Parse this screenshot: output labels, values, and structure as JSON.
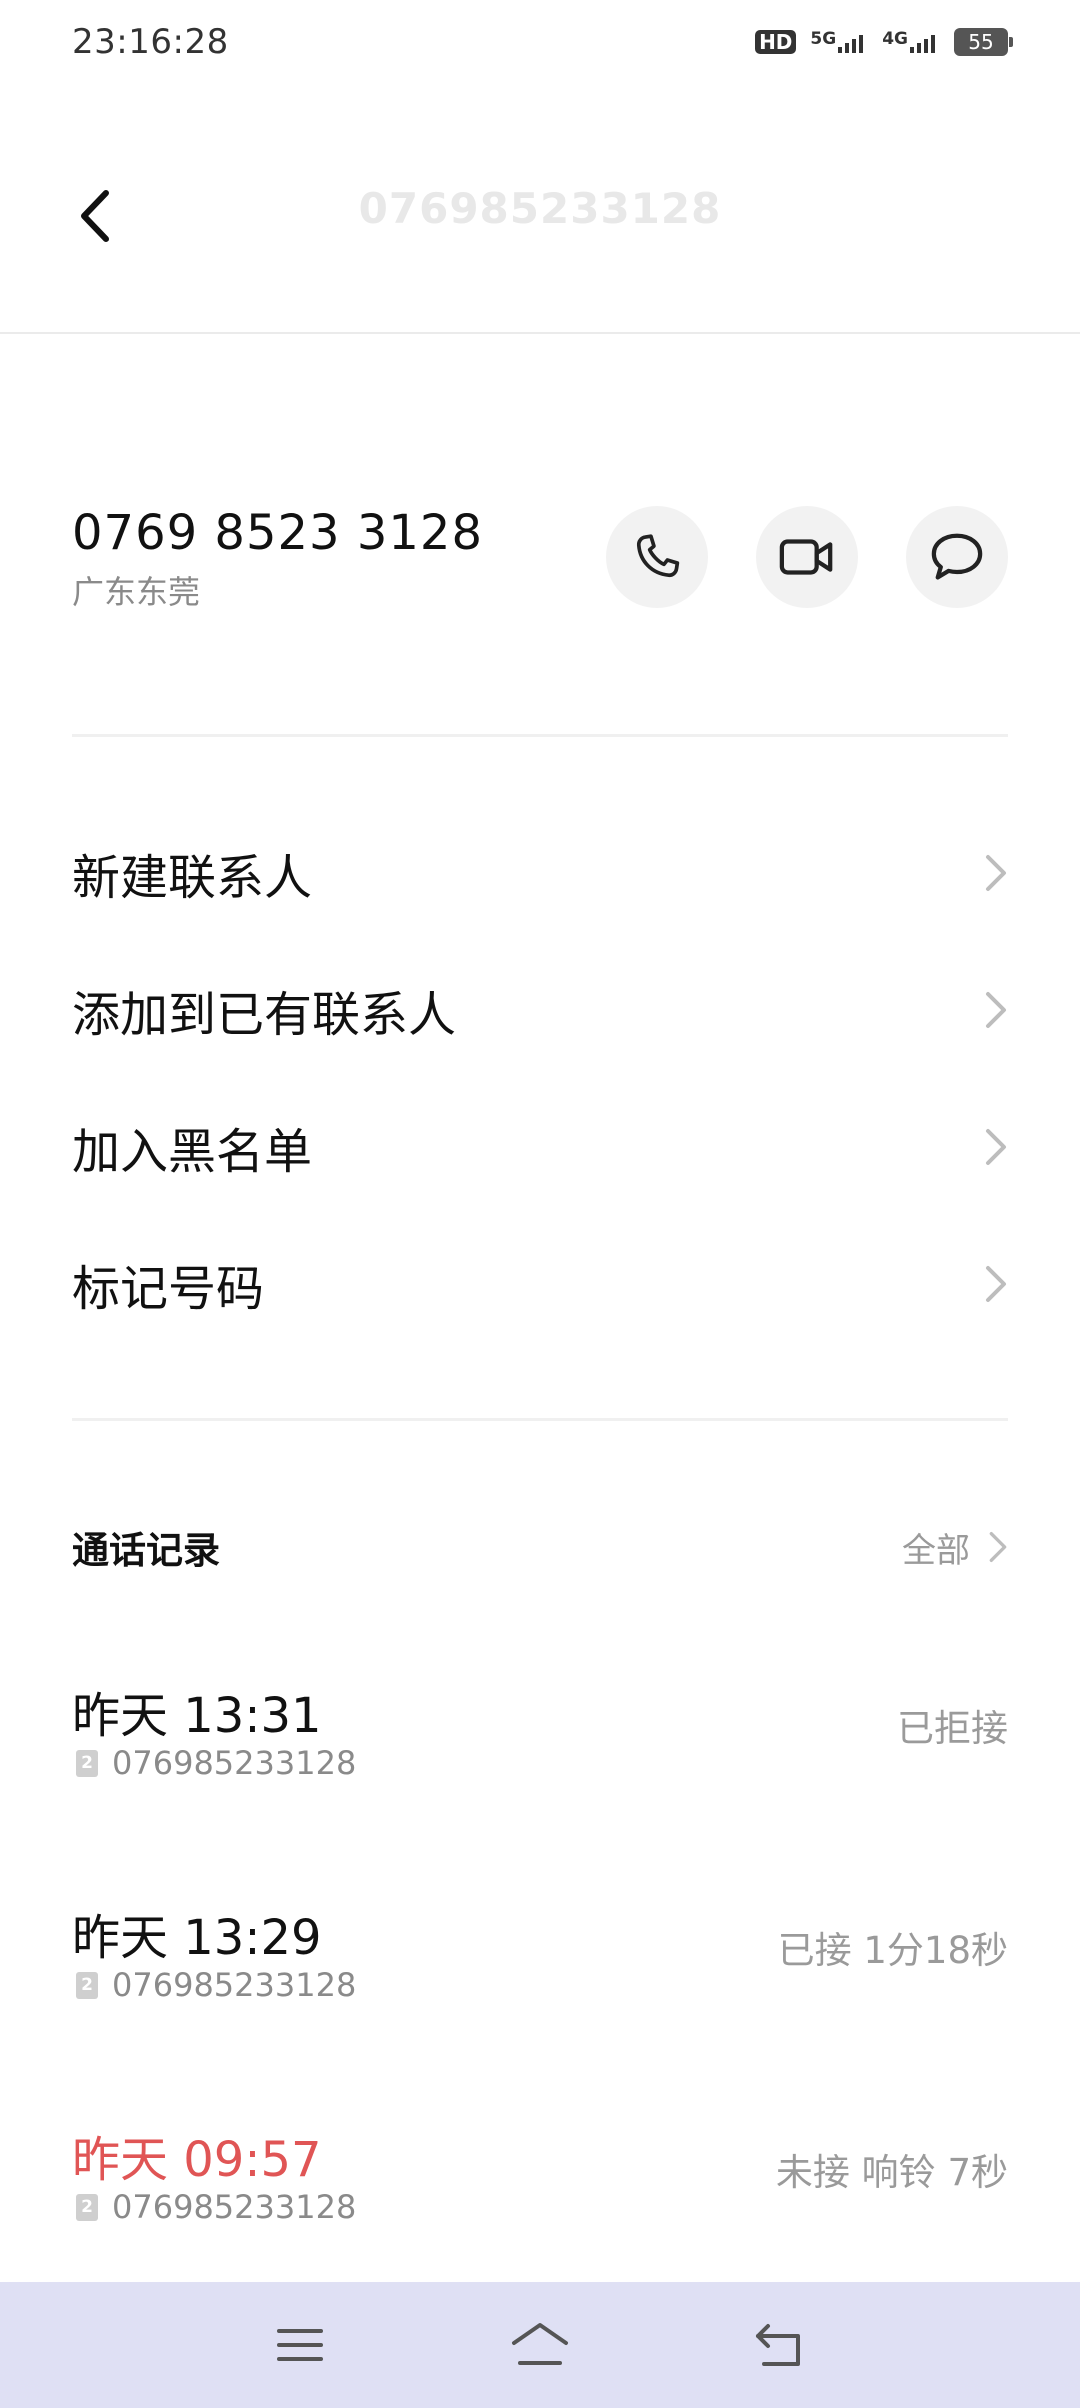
{
  "status_bar": {
    "time": "23:16:28",
    "hd_label": "HD",
    "sim1_net": "5G",
    "sim2_net": "4G",
    "battery": "55"
  },
  "header": {
    "title": "076985233128",
    "back_icon": "chevron-left-icon"
  },
  "contact": {
    "number": "0769 8523 3128",
    "region": "广东东莞",
    "actions": [
      {
        "name": "call",
        "icon": "phone-icon"
      },
      {
        "name": "video",
        "icon": "video-camera-icon"
      },
      {
        "name": "message",
        "icon": "chat-bubble-icon"
      }
    ]
  },
  "menu": {
    "items": [
      {
        "label": "新建联系人"
      },
      {
        "label": "添加到已有联系人"
      },
      {
        "label": "加入黑名单"
      },
      {
        "label": "标记号码"
      }
    ]
  },
  "records": {
    "title": "通话记录",
    "all_label": "全部",
    "items": [
      {
        "time": "昨天 13:31",
        "sim": "2",
        "number": "076985233128",
        "status": "已拒接",
        "missed": false
      },
      {
        "time": "昨天 13:29",
        "sim": "2",
        "number": "076985233128",
        "status": "已接 1分18秒",
        "missed": false
      },
      {
        "time": "昨天 09:57",
        "sim": "2",
        "number": "076985233128",
        "status": "未接 响铃 7秒",
        "missed": true
      }
    ]
  },
  "colors": {
    "missed": "#e05555",
    "nav_bg": "#dfe0f4"
  },
  "nav": {
    "icons": [
      "menu-icon",
      "home-icon",
      "back-icon"
    ]
  }
}
